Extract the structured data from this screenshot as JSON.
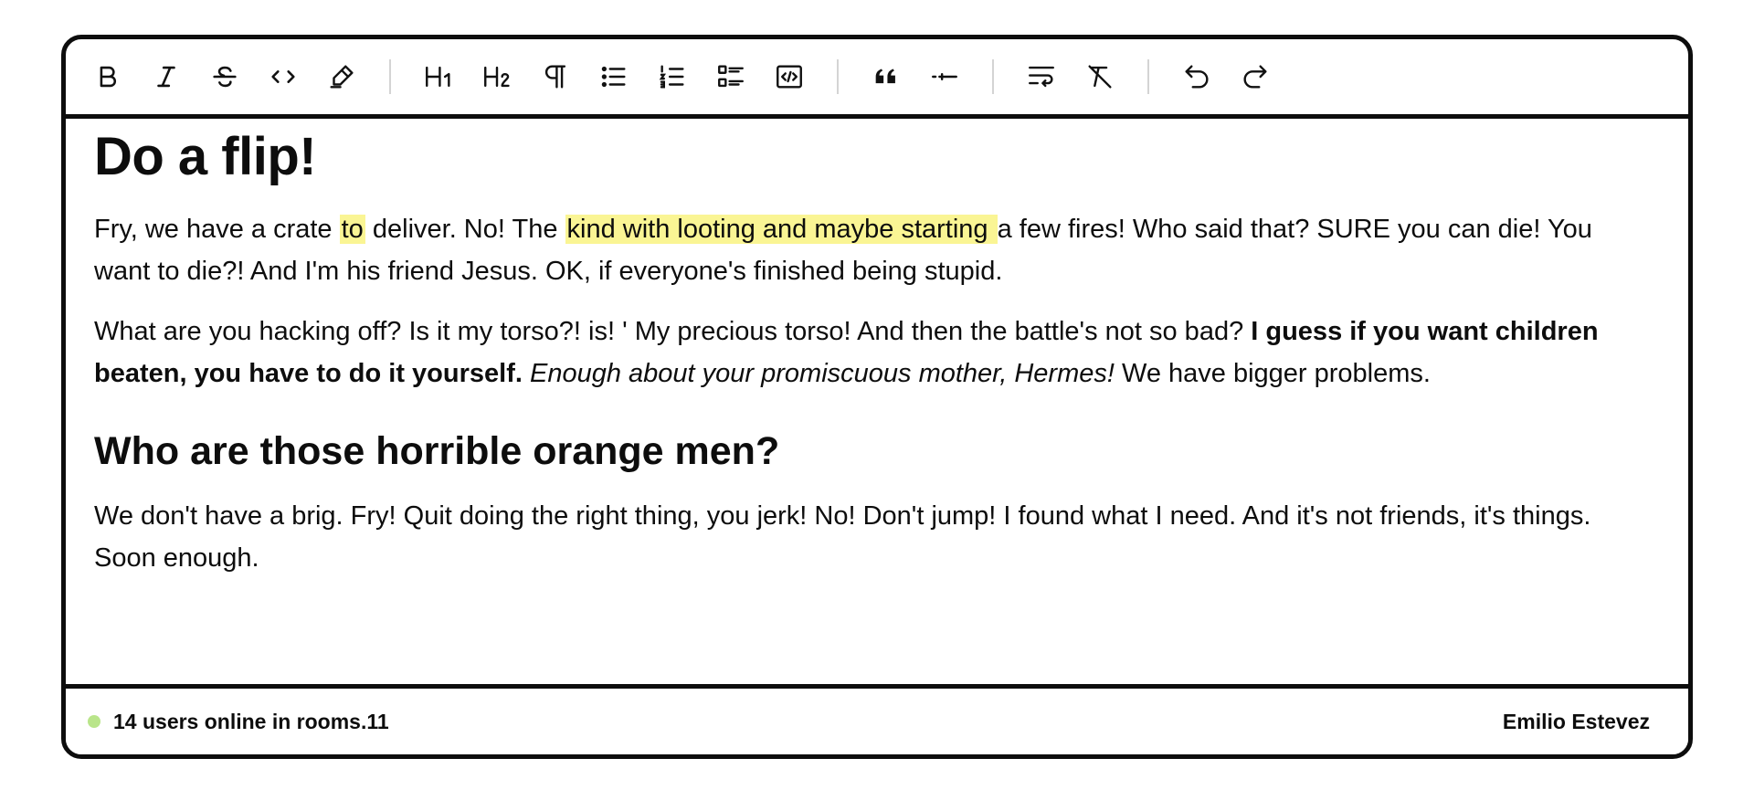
{
  "toolbar": {
    "buttons": [
      {
        "icon": "bold-icon"
      },
      {
        "icon": "italic-icon"
      },
      {
        "icon": "strikethrough-icon"
      },
      {
        "icon": "code-icon"
      },
      {
        "icon": "highlighter-icon"
      },
      {
        "icon": "heading-1-icon",
        "label": "H1"
      },
      {
        "icon": "heading-2-icon",
        "label": "H2"
      },
      {
        "icon": "paragraph-icon",
        "label": "¶"
      },
      {
        "icon": "bullet-list-icon"
      },
      {
        "icon": "ordered-list-icon"
      },
      {
        "icon": "task-list-icon"
      },
      {
        "icon": "code-block-icon"
      },
      {
        "icon": "blockquote-icon"
      },
      {
        "icon": "horizontal-rule-icon"
      },
      {
        "icon": "hard-break-icon"
      },
      {
        "icon": "clear-format-icon"
      },
      {
        "icon": "undo-icon"
      },
      {
        "icon": "redo-icon"
      }
    ]
  },
  "document": {
    "title": "Do a flip!",
    "p1": {
      "a": "Fry, we have a crate ",
      "hl1": "to",
      "b": " deliver. No! The ",
      "hl2": "kind with looting and maybe starting ",
      "c": "a few fires! Who said that? SURE you can die! You want to die?! And I'm his friend Jesus. OK, if everyone's finished being stupid."
    },
    "p2": {
      "a": "What are you hacking off? Is it my torso?!  is! ' My precious torso! And then the battle's not so bad? ",
      "bold": "I guess if you want children beaten, you have to do it yourself.",
      "sp": " ",
      "italic": "Enough about your promiscuous mother, Hermes!",
      "c": " We have bigger problems."
    },
    "h2": "Who are those horrible orange men?",
    "p3": "We don't have a brig. Fry! Quit doing the right thing, you jerk! No! Don't jump! I found what I need. And it's not friends, it's things. Soon enough."
  },
  "status": {
    "online_text": "14 users online in rooms.11",
    "user_name": "Emilio Estevez",
    "dot_color": "#b9e58a"
  },
  "colors": {
    "highlight": "#faf594",
    "border": "#0d0d0d"
  }
}
